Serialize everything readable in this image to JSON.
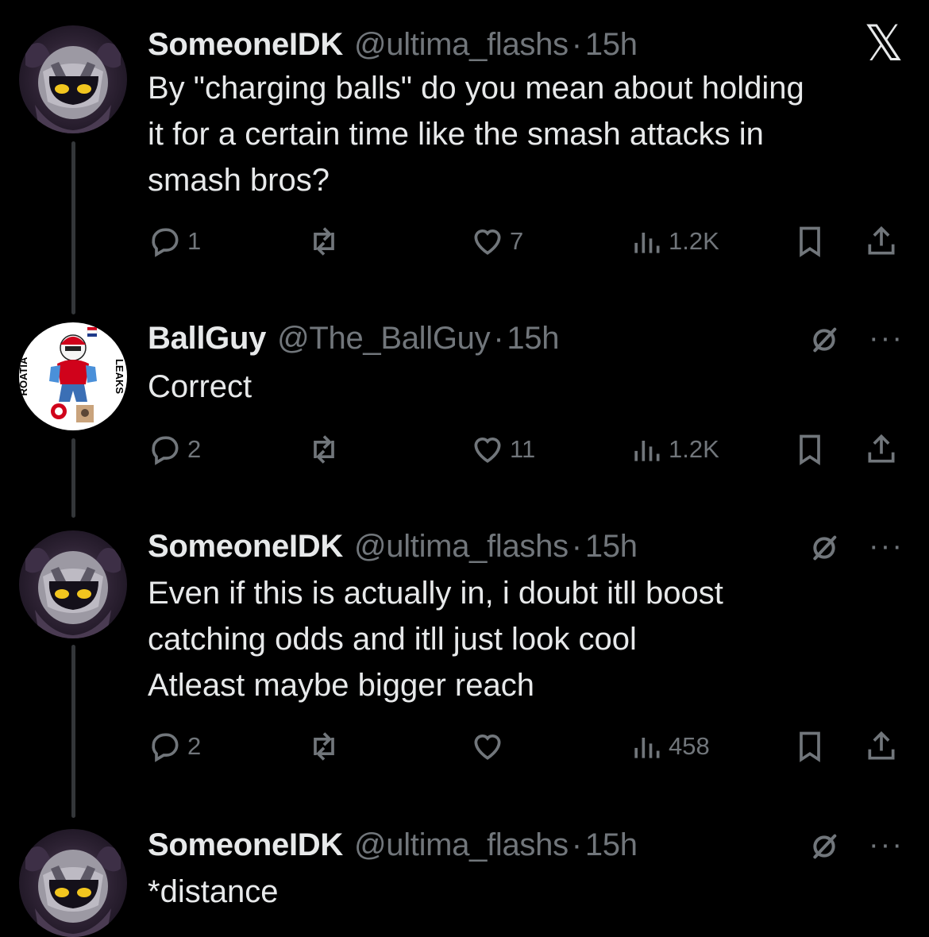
{
  "tweets": [
    {
      "name": "SomeoneIDK",
      "handle": "@ultima_flashs",
      "dot": "·",
      "time": "15h",
      "text": "By \"charging balls\" do you mean about holding\nit for a certain time like the smash attacks in\nsmash bros?",
      "replies": "1",
      "retweets": "",
      "likes": "7",
      "views": "1.2K",
      "avatar": "meta-knight-avatar"
    },
    {
      "name": "BallGuy",
      "handle": "@The_BallGuy",
      "dot": "·",
      "time": "15h",
      "text": "Correct",
      "replies": "2",
      "retweets": "",
      "likes": "11",
      "views": "1.2K",
      "avatar": "croatia-leaks-avatar",
      "avatar_text_left": "ROATIA",
      "avatar_text_right": "LEAKS"
    },
    {
      "name": "SomeoneIDK",
      "handle": "@ultima_flashs",
      "dot": "·",
      "time": "15h",
      "text": "Even if this is actually in, i doubt itll boost\ncatching odds and itll just look cool\nAtleast maybe bigger reach",
      "replies": "2",
      "retweets": "",
      "likes": "",
      "views": "458",
      "avatar": "meta-knight-avatar"
    },
    {
      "name": "SomeoneIDK",
      "handle": "@ultima_flashs",
      "dot": "·",
      "time": "15h",
      "text": "*distance",
      "avatar": "meta-knight-avatar"
    }
  ],
  "icons": {
    "close": "x-logo-icon",
    "grok": "grok-icon",
    "more": "more-icon",
    "more_glyph": "···",
    "x_glyph": "𝕏"
  },
  "colors": {
    "background": "#000000",
    "text": "#e7e9ea",
    "muted": "#71767b",
    "thread_line": "#333639"
  }
}
